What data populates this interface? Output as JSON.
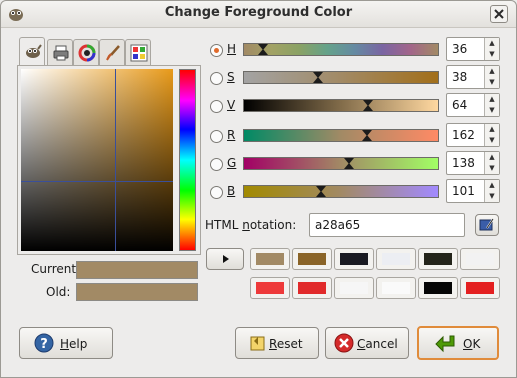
{
  "window": {
    "title": "Change Foreground Color"
  },
  "tabs": [
    {
      "icon": "gimp-wilber-icon"
    },
    {
      "icon": "printer-icon"
    },
    {
      "icon": "color-wheel-icon"
    },
    {
      "icon": "paintbrush-icon"
    },
    {
      "icon": "palette-icon"
    }
  ],
  "swatches": {
    "current_label": "Current:",
    "old_label": "Old:",
    "current_color": "#a28a65",
    "old_color": "#a28a65"
  },
  "channels": [
    {
      "key": "H",
      "value": "36",
      "checked": true,
      "fraction": 0.1
    },
    {
      "key": "S",
      "value": "38",
      "checked": false,
      "fraction": 0.38
    },
    {
      "key": "V",
      "value": "64",
      "checked": false,
      "fraction": 0.64
    },
    {
      "key": "R",
      "value": "162",
      "checked": false,
      "fraction": 0.635
    },
    {
      "key": "G",
      "value": "138",
      "checked": false,
      "fraction": 0.54
    },
    {
      "key": "B",
      "value": "101",
      "checked": false,
      "fraction": 0.395
    }
  ],
  "html_notation": {
    "label_prefix": "HTML ",
    "label_mnemonic": "n",
    "label_rest": "otation:",
    "value": "a28a65"
  },
  "history_colors": [
    "#a28a65",
    "#8a6428",
    "#1a1b23",
    "#eceef3",
    "#23241a",
    "#f2f2f2",
    "#ee3a3a",
    "#e12a2a",
    "#f6f6f6",
    "#fafafa",
    "#050505",
    "#e42020"
  ],
  "buttons": {
    "help": {
      "mn": "H",
      "rest": "elp"
    },
    "reset": {
      "mn": "R",
      "rest": "eset"
    },
    "cancel": {
      "mn": "C",
      "rest": "ancel"
    },
    "ok": {
      "mn": "O",
      "rest": "K"
    }
  },
  "colors": {
    "accent": "#e06a2b",
    "ok_border": "#e08b3a"
  }
}
